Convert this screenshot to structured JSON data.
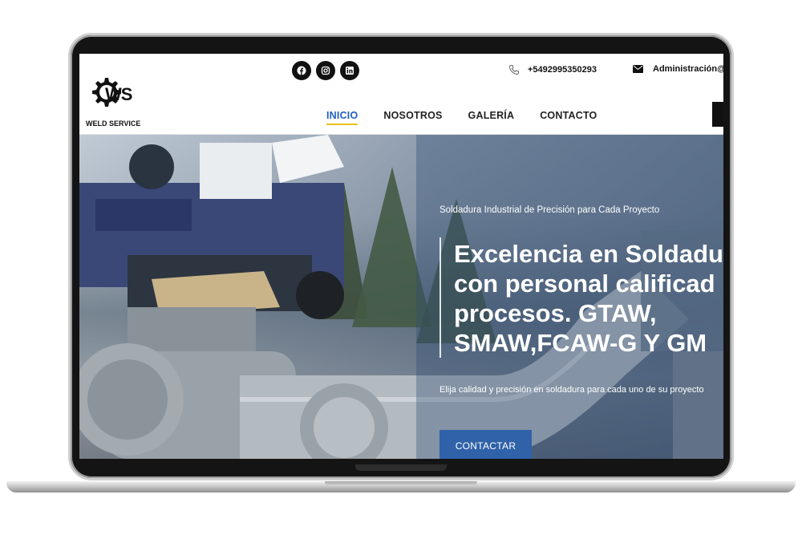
{
  "brand": {
    "logo_mark": "WS",
    "name": "WELD SERVICE"
  },
  "social": [
    {
      "icon": "facebook-icon"
    },
    {
      "icon": "instagram-icon"
    },
    {
      "icon": "linkedin-icon"
    }
  ],
  "contact": {
    "phone": "+5492995350293",
    "email": "Administración@"
  },
  "nav": [
    {
      "label": "INICIO",
      "active": true
    },
    {
      "label": "NOSOTROS",
      "active": false
    },
    {
      "label": "GALERÍA",
      "active": false
    },
    {
      "label": "CONTACTO",
      "active": false
    }
  ],
  "hero": {
    "subtitle": "Soldadura Industrial de Precisión para Cada Proyecto",
    "title": "Excelencia en Soldadu\ncon personal calificad\nprocesos. GTAW,\nSMAW,FCAW-G Y GM",
    "description": "Elija calidad y precisión en soldadura para cada uno de su proyecto",
    "button": "CONTACTAR"
  },
  "colors": {
    "accent_blue": "#2f62a8",
    "nav_active": "#1f5fbf",
    "nav_underline": "#e8c21a"
  }
}
